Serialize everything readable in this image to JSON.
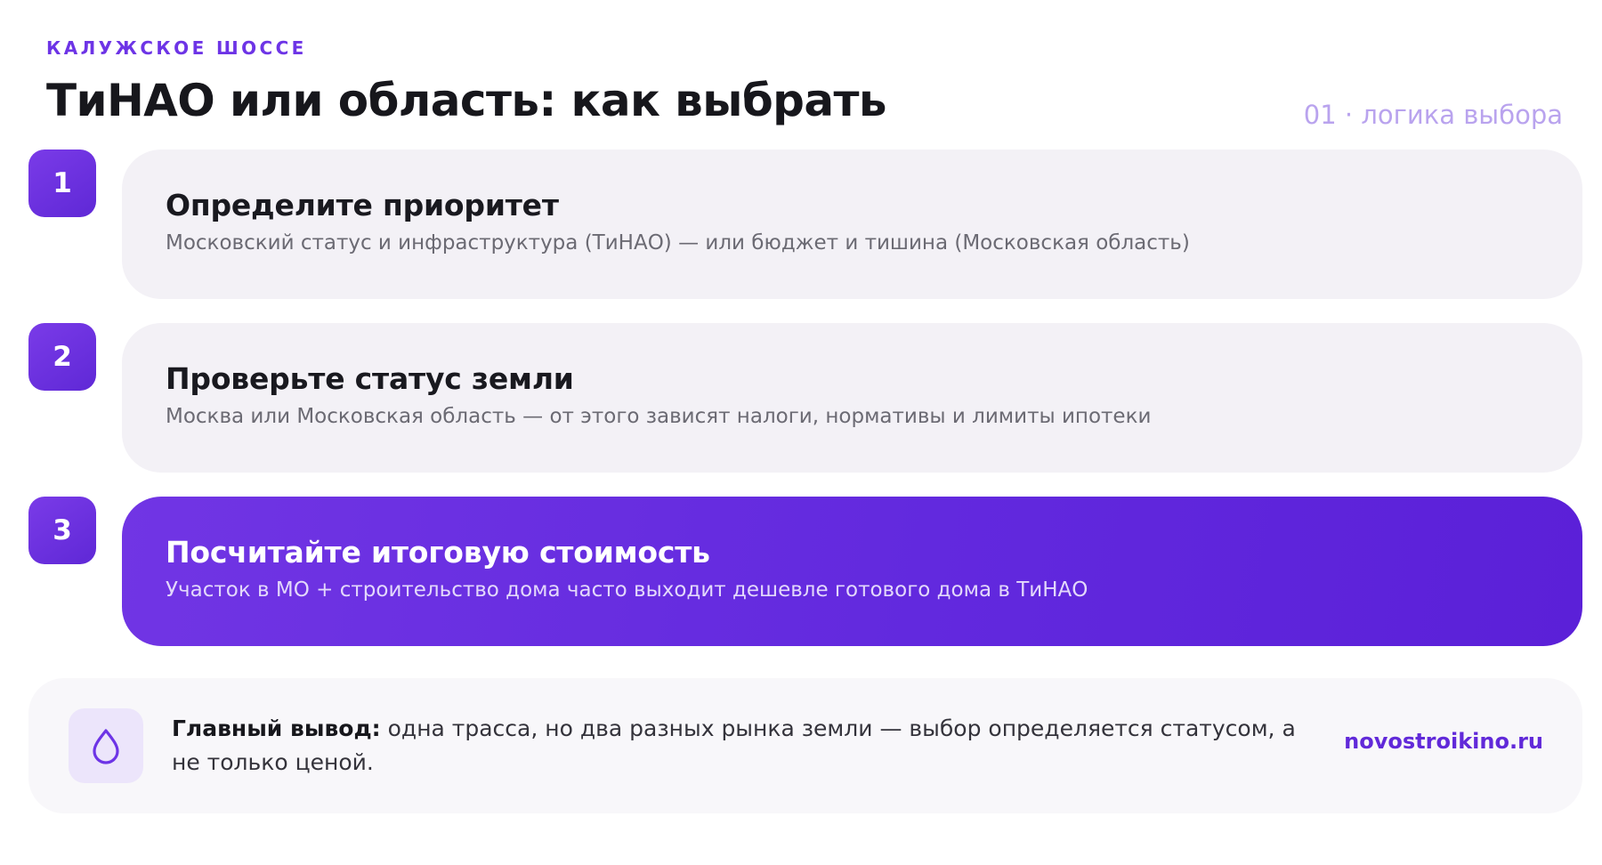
{
  "header": {
    "eyebrow": "КАЛУЖСКОЕ ШОССЕ",
    "title": "ТиНАО или область: как выбрать",
    "section_tag": "01 · логика выбора"
  },
  "steps": [
    {
      "number": "1",
      "title": "Определите приоритет",
      "text": "Московский статус и инфраструктура (ТиНАО) — или бюджет и тишина (Московская область)"
    },
    {
      "number": "2",
      "title": "Проверьте статус земли",
      "text": "Москва или Московская область — от этого зависят налоги, нормативы и лимиты ипотеки"
    },
    {
      "number": "3",
      "title": "Посчитайте итоговую стоимость",
      "text": "Участок в МО + строительство дома часто выходит дешевле готового дома в ТиНАО"
    }
  ],
  "summary": {
    "icon": "drop-icon",
    "label": "Главный вывод:",
    "text": "одна трасса, но два разных рынка земли — выбор определяется статусом, а не только ценой.",
    "site": "novostroikino.ru"
  },
  "colors": {
    "accent": "#6d34e6",
    "card_bg": "#f3f1f6",
    "active_card_start": "#7135e4",
    "active_card_end": "#5b20d8",
    "muted_tag": "#b9a3ee"
  }
}
